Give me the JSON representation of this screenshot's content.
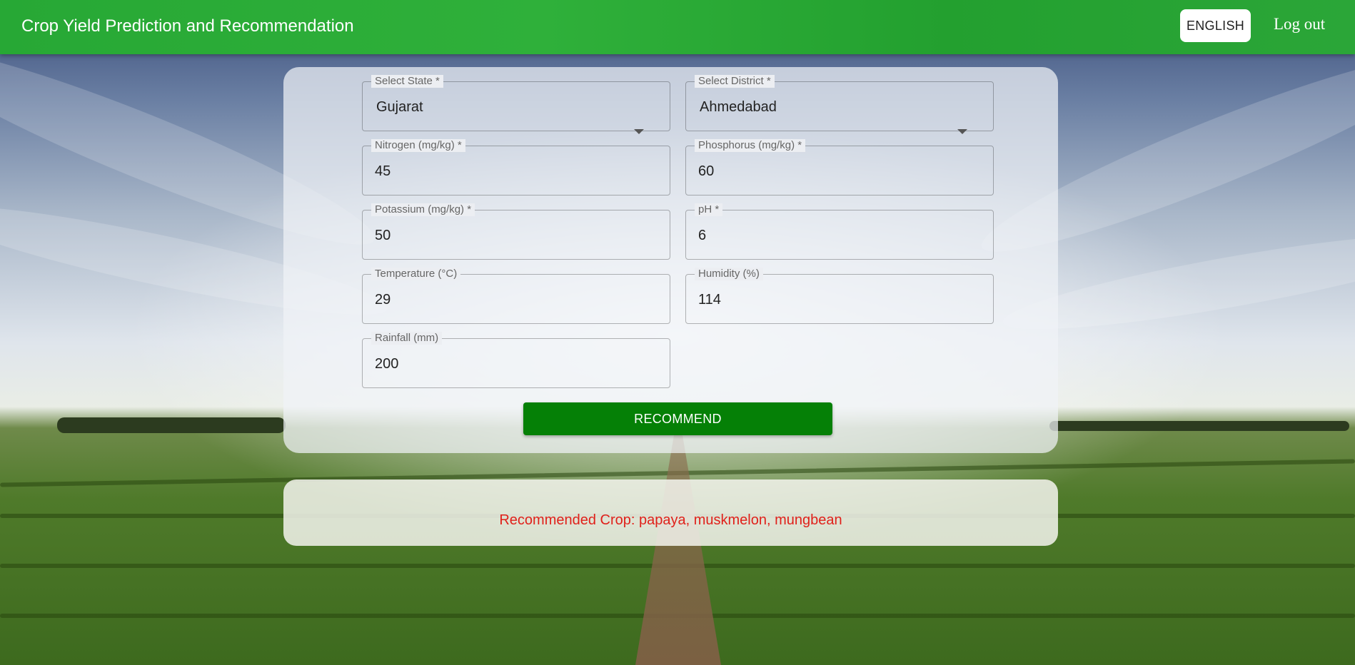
{
  "header": {
    "title": "Crop Yield Prediction and Recommendation",
    "language_button": "ENGLISH",
    "logout_label": "Log out"
  },
  "form": {
    "state": {
      "label": "Select State *",
      "value": "Gujarat"
    },
    "district": {
      "label": "Select District *",
      "value": "Ahmedabad"
    },
    "nitrogen": {
      "label": "Nitrogen (mg/kg) *",
      "value": "45"
    },
    "phosphorus": {
      "label": "Phosphorus (mg/kg) *",
      "value": "60"
    },
    "potassium": {
      "label": "Potassium (mg/kg) *",
      "value": "50"
    },
    "ph": {
      "label": "pH *",
      "value": "6"
    },
    "temperature": {
      "label": "Temperature (°C)",
      "value": "29"
    },
    "humidity": {
      "label": "Humidity (%)",
      "value": "114"
    },
    "rainfall": {
      "label": "Rainfall (mm)",
      "value": "200"
    },
    "submit_label": "RECOMMEND"
  },
  "result": {
    "text": "Recommended Crop: papaya, muskmelon, mungbean",
    "color": "#e0201a"
  },
  "theme": {
    "appbar_color": "#2ba638",
    "button_color": "#058006"
  }
}
